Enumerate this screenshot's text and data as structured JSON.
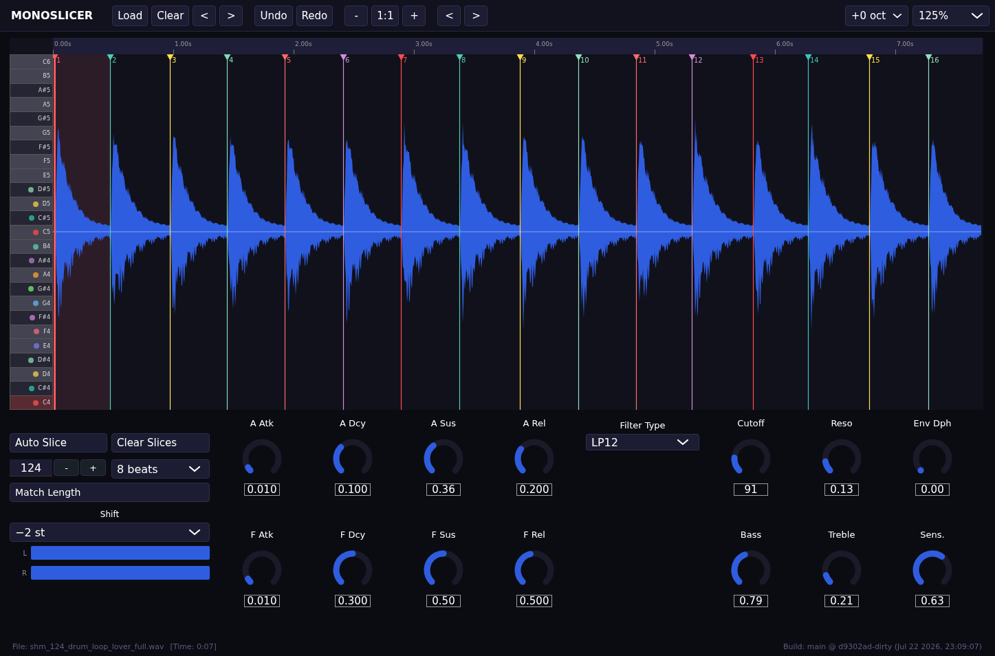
{
  "app": {
    "title": "MONOSLICER"
  },
  "toolbar": {
    "groups": [
      [
        "Load",
        "Clear",
        "<",
        ">"
      ],
      [
        "Undo",
        "Redo"
      ],
      [
        "-",
        "1:1",
        "+"
      ],
      [
        "<",
        ">"
      ]
    ],
    "octave": "+0 oct",
    "zoom": "125%"
  },
  "ruler": [
    "0.00s",
    "1.00s",
    "2.00s",
    "3.00s",
    "4.00s",
    "5.00s",
    "6.00s",
    "7.00s"
  ],
  "slices": [
    {
      "label": "1",
      "color": "#ff5a5f",
      "selected": true
    },
    {
      "label": "2",
      "color": "#4ecdb4",
      "selected": false
    },
    {
      "label": "3",
      "color": "#ffe14d",
      "selected": false
    },
    {
      "label": "4",
      "color": "#7fdcb8",
      "selected": false
    },
    {
      "label": "5",
      "color": "#ff6b6b",
      "selected": false
    },
    {
      "label": "6",
      "color": "#d38fd8",
      "selected": false
    },
    {
      "label": "7",
      "color": "#ff4d4d",
      "selected": false
    },
    {
      "label": "8",
      "color": "#4ecdb4",
      "selected": false
    },
    {
      "label": "9",
      "color": "#ffe14d",
      "selected": false
    },
    {
      "label": "10",
      "color": "#8fe0c0",
      "selected": false
    },
    {
      "label": "11",
      "color": "#ff6b70",
      "selected": false
    },
    {
      "label": "12",
      "color": "#d38fd8",
      "selected": false
    },
    {
      "label": "13",
      "color": "#ff4d4d",
      "selected": false
    },
    {
      "label": "14",
      "color": "#3fc4b8",
      "selected": false
    },
    {
      "label": "15",
      "color": "#ffe14d",
      "selected": false
    },
    {
      "label": "16",
      "color": "#8fe0c0",
      "selected": false
    }
  ],
  "keys": [
    {
      "note": "C6",
      "kind": "white",
      "selected": false
    },
    {
      "note": "B5",
      "kind": "white",
      "selected": false
    },
    {
      "note": "A#5",
      "kind": "black",
      "selected": false
    },
    {
      "note": "A5",
      "kind": "white",
      "selected": false
    },
    {
      "note": "G#5",
      "kind": "black",
      "selected": false
    },
    {
      "note": "G5",
      "kind": "white",
      "selected": false
    },
    {
      "note": "F#5",
      "kind": "black",
      "selected": false
    },
    {
      "note": "F5",
      "kind": "white",
      "selected": false
    },
    {
      "note": "E5",
      "kind": "white",
      "selected": false
    },
    {
      "note": "D#5",
      "kind": "black",
      "selected": false,
      "color": "#6fae8f"
    },
    {
      "note": "D5",
      "kind": "white",
      "selected": false,
      "color": "#c9b048"
    },
    {
      "note": "C#5",
      "kind": "black",
      "selected": false,
      "color": "#2a9d8f"
    },
    {
      "note": "C5",
      "kind": "white",
      "selected": false,
      "color": "#d04a4a"
    },
    {
      "note": "B4",
      "kind": "white",
      "selected": false,
      "color": "#5aad93"
    },
    {
      "note": "A#4",
      "kind": "black",
      "selected": false,
      "color": "#8e6a9e"
    },
    {
      "note": "A4",
      "kind": "white",
      "selected": false,
      "color": "#d08a3a"
    },
    {
      "note": "G#4",
      "kind": "black",
      "selected": false,
      "color": "#5cbf5c"
    },
    {
      "note": "G4",
      "kind": "white",
      "selected": false,
      "color": "#5b9bc4"
    },
    {
      "note": "F#4",
      "kind": "black",
      "selected": false,
      "color": "#a86aa8"
    },
    {
      "note": "F4",
      "kind": "white",
      "selected": false,
      "color": "#c8606a"
    },
    {
      "note": "E4",
      "kind": "white",
      "selected": false,
      "color": "#6a6ad0"
    },
    {
      "note": "D#4",
      "kind": "black",
      "selected": false,
      "color": "#6fae8f"
    },
    {
      "note": "D4",
      "kind": "white",
      "selected": false,
      "color": "#c9b048"
    },
    {
      "note": "C#4",
      "kind": "black",
      "selected": false,
      "color": "#2a9d8f"
    },
    {
      "note": "C4",
      "kind": "white",
      "selected": true,
      "color": "#d04a4a"
    }
  ],
  "slice_controls": {
    "auto_slice": "Auto Slice",
    "clear_slices": "Clear Slices",
    "bpm": "124",
    "decrement": "-",
    "increment": "+",
    "length": "8 beats",
    "match_length": "Match Length",
    "shift_label": "Shift",
    "shift": "−2 st"
  },
  "meters": [
    {
      "label": "L",
      "level": 1
    },
    {
      "label": "R",
      "level": 1
    }
  ],
  "amp_knobs": [
    {
      "label": "A Atk",
      "value": "0.010"
    },
    {
      "label": "A Dcy",
      "value": "0.100"
    },
    {
      "label": "A Sus",
      "value": "0.36"
    },
    {
      "label": "A Rel",
      "value": "0.200"
    }
  ],
  "filter_env_knobs": [
    {
      "label": "F Atk",
      "value": "0.010"
    },
    {
      "label": "F Dcy",
      "value": "0.300"
    },
    {
      "label": "F Sus",
      "value": "0.50"
    },
    {
      "label": "F Rel",
      "value": "0.500"
    }
  ],
  "filter": {
    "label": "Filter Type",
    "value": "LP12"
  },
  "filter_knobs": [
    {
      "label": "Cutoff",
      "value": "91"
    },
    {
      "label": "Reso",
      "value": "0.13"
    },
    {
      "label": "Env Dph",
      "value": "0.00"
    }
  ],
  "tone_knobs": [
    {
      "label": "Bass",
      "value": "0.79"
    },
    {
      "label": "Treble",
      "value": "0.21"
    },
    {
      "label": "Sens.",
      "value": "0.63"
    }
  ],
  "status_bar": {
    "file": "File: shm_124_drum_loop_lover_full.wav",
    "time": "[Time: 0:07]",
    "build": "Build: main @ d9302ad-dirty (Jul 22 2026, 23:09:07)"
  }
}
